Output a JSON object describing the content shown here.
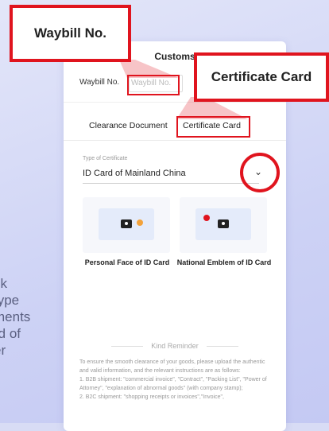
{
  "left_text": [
    "ck",
    "type",
    "ments",
    "rd of",
    "er"
  ],
  "header": {
    "title": "Customs"
  },
  "waybill": {
    "label": "Waybill No.",
    "placeholder": "Waybill No."
  },
  "tabs": [
    {
      "label": "Clearance Document"
    },
    {
      "label": "Certificate Card"
    }
  ],
  "certificate": {
    "type_label": "Type of Certificate",
    "type_value": "ID Card of Mainland China"
  },
  "cards": [
    {
      "caption": "Personal Face of ID Card"
    },
    {
      "caption": "National Emblem of ID Card"
    }
  ],
  "reminder": {
    "title": "Kind Reminder",
    "text": "To ensure the smooth clearance of your goods, please upload the authentic and valid information, and the relevant instructions are as follows:",
    "item1": "1. B2B shipment: \"commercial invoice\", \"Contract\", \"Packing List\", \"Power of Attorney\", \"explanation of abnormal goods\" (with company stamp);",
    "item2": "2. B2C shipment: \"shopping receipts or invoices\",\"Invoice\","
  },
  "callouts": {
    "waybill": "Waybill No.",
    "certificate": "Certificate Card"
  },
  "colors": {
    "accent": "#e0141e",
    "background": "#d8dcf5"
  }
}
